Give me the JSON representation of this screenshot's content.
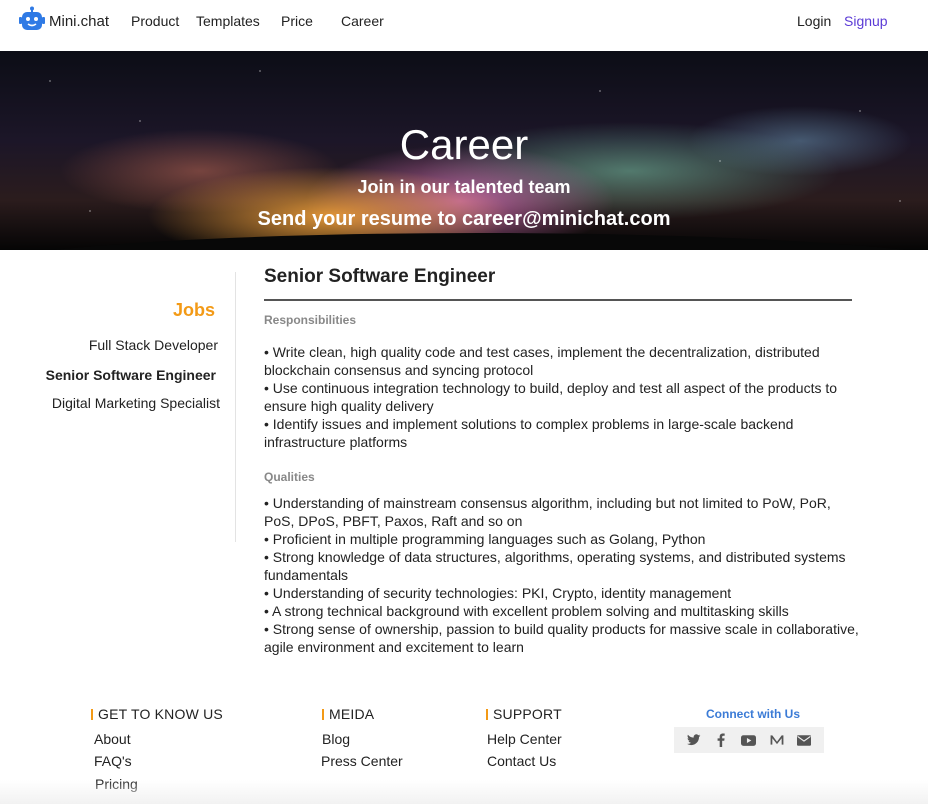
{
  "brand": {
    "name": "Mini.chat"
  },
  "nav": {
    "items": [
      "Product",
      "Templates",
      "Price",
      "Career"
    ],
    "login": "Login",
    "signup": "Signup",
    "signup_color": "#5b3bd6"
  },
  "hero": {
    "title": "Career",
    "subtitle": "Join in our talented team",
    "contact": "Send your resume to career@minichat.com"
  },
  "sidebar": {
    "heading": "Jobs",
    "jobs": [
      "Full Stack Developer",
      "Senior Software Engineer",
      "Digital Marketing Specialist"
    ],
    "active": "Senior Software Engineer"
  },
  "job": {
    "title": "Senior Software Engineer",
    "responsibilities_label": "Responsibilities",
    "responsibilities": [
      "• Write clean, high quality code and test cases, implement the decentralization, distributed blockchain consensus and syncing protocol",
      "• Use continuous integration technology to build, deploy and test all aspect of the products to ensure high quality delivery",
      "• Identify issues and implement solutions to complex problems in large-scale backend infrastructure platforms"
    ],
    "qualities_label": "Qualities",
    "qualities": [
      "• Understanding of mainstream consensus algorithm, including but not limited to PoW, PoR, PoS, DPoS, PBFT, Paxos, Raft and so on",
      "• Proficient in multiple programming languages such as Golang, Python",
      "• Strong knowledge of data structures, algorithms, operating systems, and distributed systems fundamentals",
      "• Understanding of security technologies: PKI, Crypto, identity management",
      "• A strong technical background with excellent problem solving and multitasking skills",
      "• Strong sense of ownership, passion to build quality products for massive scale in collaborative, agile environment and excitement to learn"
    ]
  },
  "footer": {
    "know_us": {
      "heading": "GET TO KNOW US",
      "links": [
        "About",
        "FAQ's",
        "Pricing"
      ]
    },
    "media": {
      "heading": "MEIDA",
      "links": [
        "Blog",
        "Press Center"
      ]
    },
    "support": {
      "heading": "SUPPORT",
      "links": [
        "Help Center",
        "Contact Us"
      ]
    },
    "connect": {
      "label": "Connect with Us",
      "icons": [
        "twitter-icon",
        "facebook-icon",
        "youtube-icon",
        "medium-icon",
        "email-icon"
      ]
    }
  },
  "colors": {
    "accent": "#f39a16",
    "link_blue": "#3b7bd6",
    "signup": "#5b3bd6"
  }
}
